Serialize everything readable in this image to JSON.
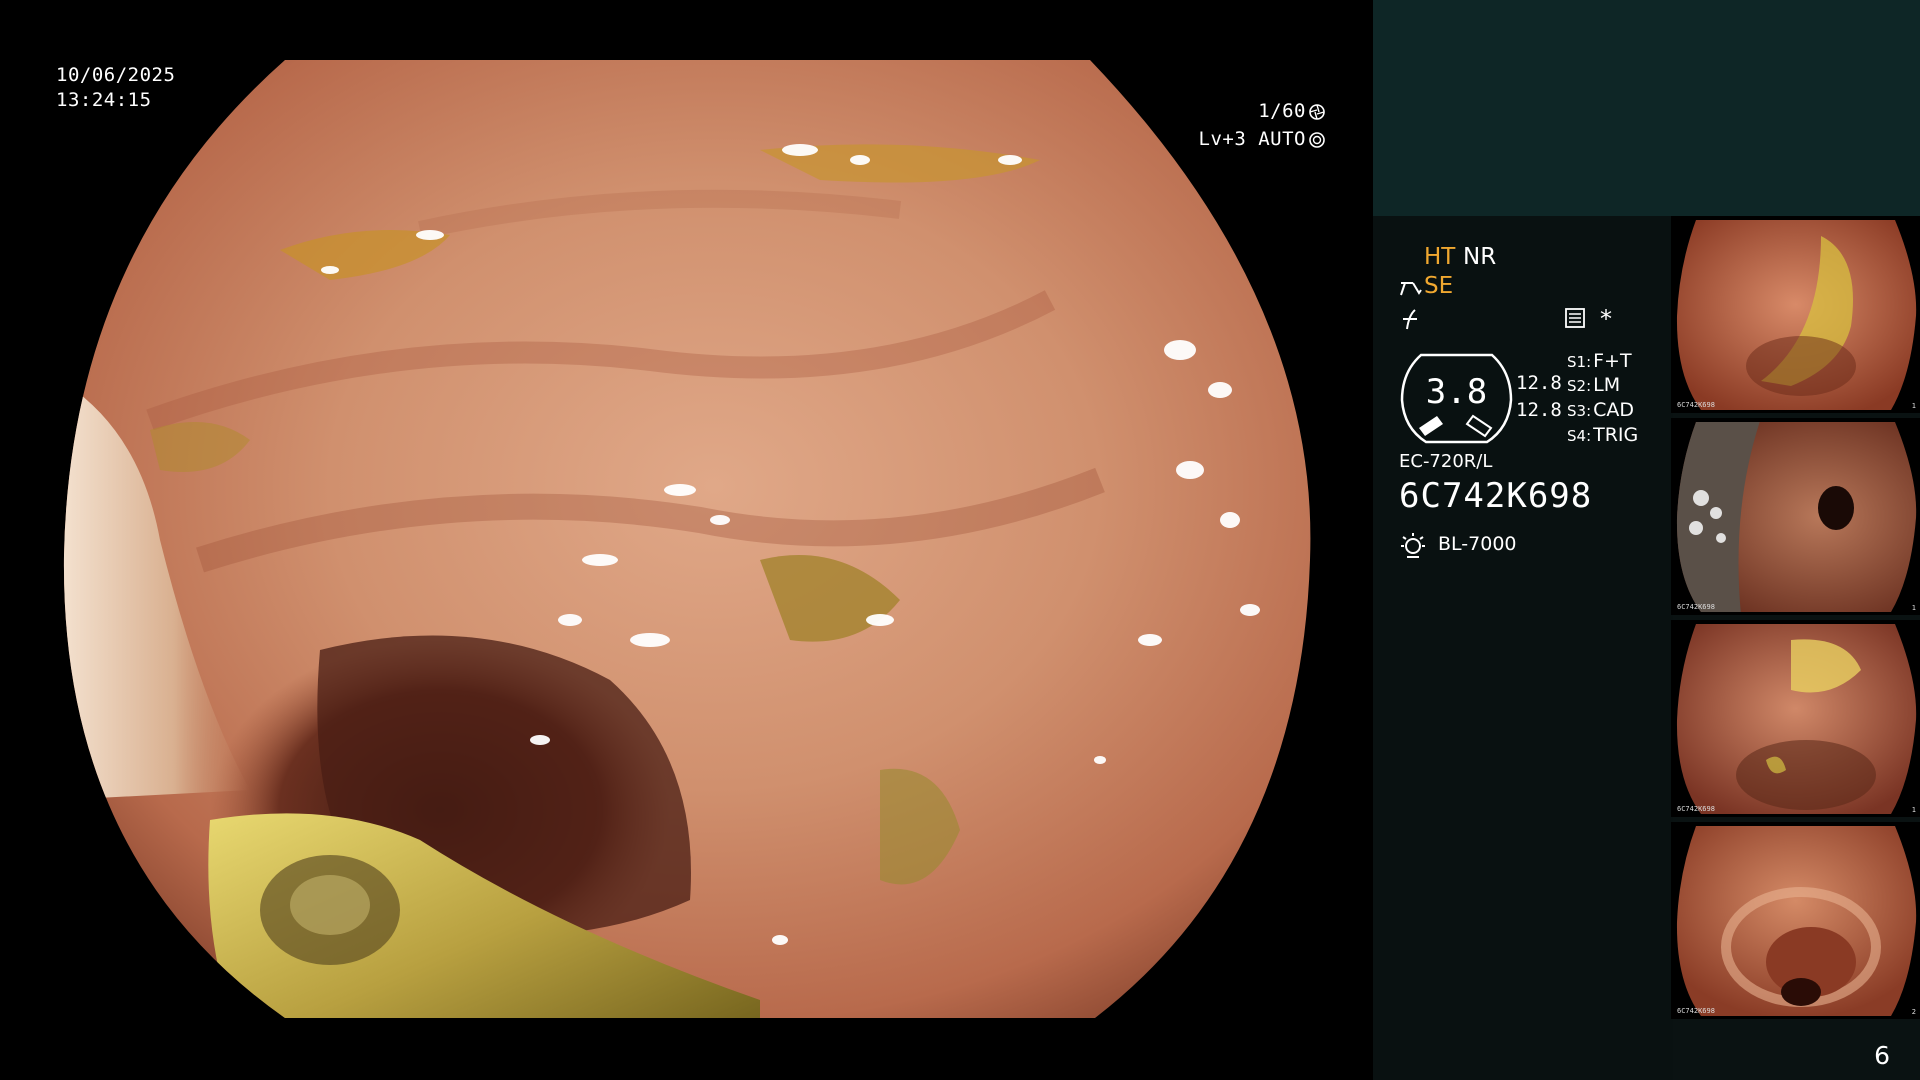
{
  "osd": {
    "date": "10/06/2025",
    "time": "13:24:15",
    "shutter": "1/60",
    "level": "Lv+3 AUTO"
  },
  "panel": {
    "mode_ht": "HT",
    "mode_nr": "NR",
    "mode_se": "SE",
    "star": "*",
    "gauge_value": "3.8",
    "gauge_side": [
      "12.8",
      "12.8"
    ],
    "scope_buttons": [
      {
        "key": "S1:",
        "value": "F+T"
      },
      {
        "key": "S2:",
        "value": "LM"
      },
      {
        "key": "S3:",
        "value": "CAD"
      },
      {
        "key": "S4:",
        "value": "TRIG"
      }
    ],
    "model": "EC-720R/L",
    "serial": "6C742K698",
    "light_source": "BL-7000",
    "accent_color": "#f0a830",
    "panel_top_color": "#0e2626"
  },
  "thumbnails": [
    {
      "label": "6C742K698",
      "index": "1"
    },
    {
      "label": "6C742K698",
      "index": "1"
    },
    {
      "label": "6C742K698",
      "index": "1"
    },
    {
      "label": "6C742K698",
      "index": "2"
    }
  ],
  "page_number": "6"
}
